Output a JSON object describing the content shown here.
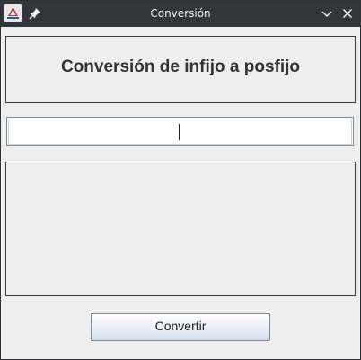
{
  "window": {
    "title": "Conversión",
    "app_icon": "java-app-icon",
    "pin_icon": "pin-icon",
    "minimize_icon": "chevron-down-icon",
    "close_icon": "close-icon"
  },
  "header": {
    "title": "Conversión de infijo a posfijo"
  },
  "input": {
    "value": "",
    "placeholder": ""
  },
  "output": {
    "text": ""
  },
  "actions": {
    "convert_label": "Convertir"
  },
  "colors": {
    "titlebar": "#31363b",
    "window_bg": "#eeeeee",
    "button_gradient_bottom": "#d3deeb"
  }
}
